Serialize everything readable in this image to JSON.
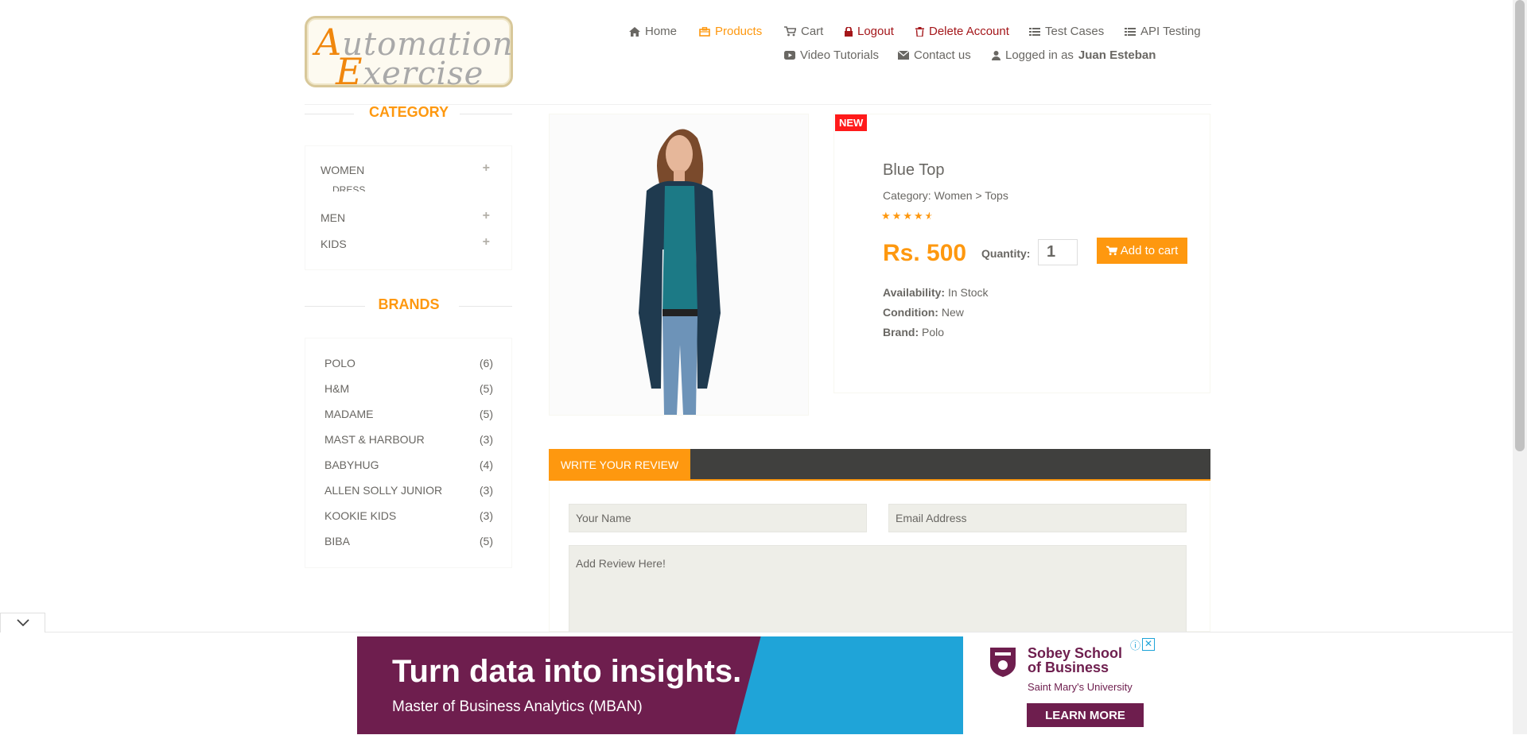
{
  "header": {
    "logo": {
      "line1_cap": "A",
      "line1_rest": "utomation",
      "line2_cap": "E",
      "line2_rest": "xercise"
    },
    "nav": [
      {
        "label": "Home",
        "icon": "home-icon"
      },
      {
        "label": "Products",
        "icon": "products-icon"
      },
      {
        "label": "Cart",
        "icon": "cart-icon"
      },
      {
        "label": "Logout",
        "icon": "lock-icon"
      },
      {
        "label": "Delete Account",
        "icon": "trash-icon"
      },
      {
        "label": "Test Cases",
        "icon": "list-icon"
      },
      {
        "label": "API Testing",
        "icon": "list-icon"
      },
      {
        "label": "Video Tutorials",
        "icon": "youtube-icon"
      },
      {
        "label": "Contact us",
        "icon": "envelope-icon"
      }
    ],
    "logged_in_prefix": "Logged in as",
    "logged_in_user": "Juan Esteban"
  },
  "sidebar": {
    "category_title": "CATEGORY",
    "categories": [
      {
        "label": "WOMEN",
        "expand": "+"
      },
      {
        "label": "DRESS"
      },
      {
        "label": "MEN",
        "expand": "+"
      },
      {
        "label": "KIDS",
        "expand": "+"
      }
    ],
    "brands_title": "BRANDS",
    "brands": [
      {
        "name": "POLO",
        "count": "(6)"
      },
      {
        "name": "H&M",
        "count": "(5)"
      },
      {
        "name": "MADAME",
        "count": "(5)"
      },
      {
        "name": "MAST & HARBOUR",
        "count": "(3)"
      },
      {
        "name": "BABYHUG",
        "count": "(4)"
      },
      {
        "name": "ALLEN SOLLY JUNIOR",
        "count": "(3)"
      },
      {
        "name": "KOOKIE KIDS",
        "count": "(3)"
      },
      {
        "name": "BIBA",
        "count": "(5)"
      }
    ]
  },
  "product": {
    "badge": "NEW",
    "name": "Blue Top",
    "category": "Category: Women > Tops",
    "rating": 4.5,
    "price": "Rs. 500",
    "quantity_label": "Quantity:",
    "quantity_value": "1",
    "add_to_cart": "Add to cart",
    "availability_label": "Availability:",
    "availability": "In Stock",
    "condition_label": "Condition:",
    "condition": "New",
    "brand_label": "Brand:",
    "brand": "Polo"
  },
  "review": {
    "tab": "WRITE YOUR REVIEW",
    "name_placeholder": "Your Name",
    "email_placeholder": "Email Address",
    "review_placeholder": "Add Review Here!"
  },
  "ad": {
    "headline": "Turn data into insights.",
    "sub": "Master of Business Analytics (MBAN)",
    "school_line1": "Sobey School",
    "school_line2": "of Business",
    "university": "Saint Mary's University",
    "cta": "LEARN MORE",
    "close": "✕",
    "info": "ⓘ"
  },
  "colors": {
    "accent": "#fe980f",
    "danger": "#a4161a",
    "dark_bar": "#40403e",
    "ad_blue": "#1fa4d8",
    "ad_maroon": "#6e1e4e"
  }
}
